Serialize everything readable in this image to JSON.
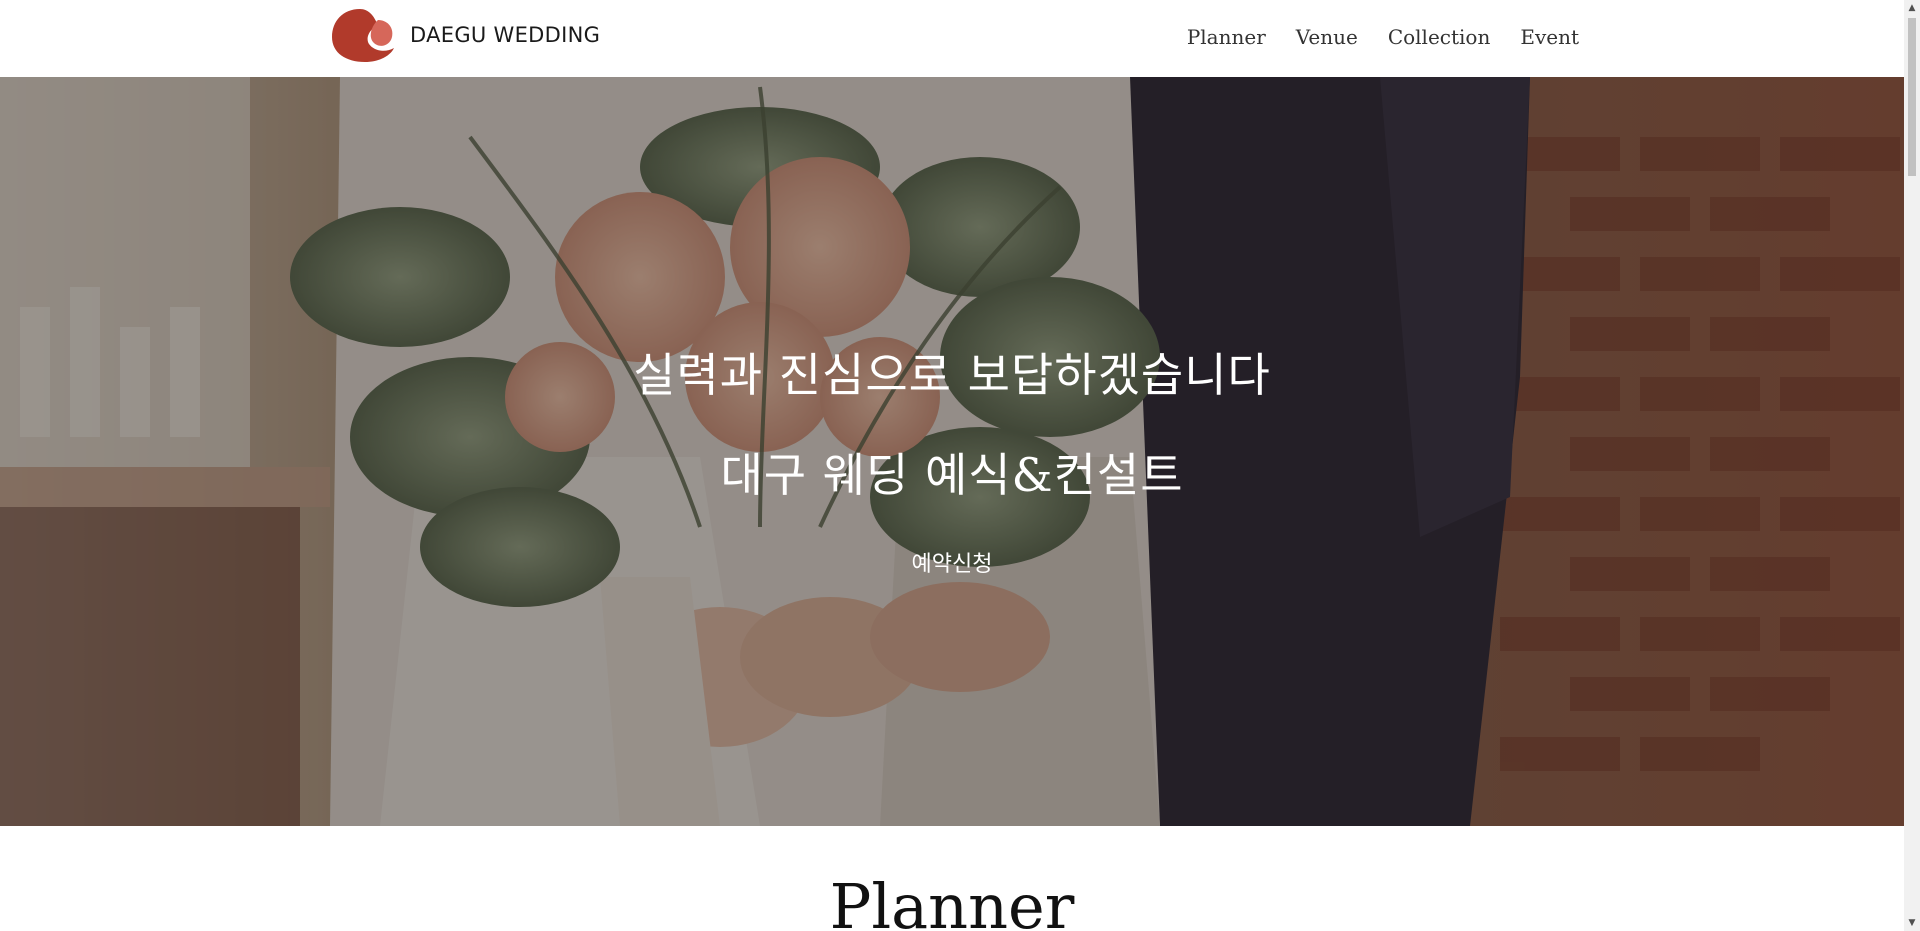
{
  "header": {
    "brand": "DAEGU WEDDING",
    "logo_icon": "red-petal-logo-icon",
    "accent_color": "#b13a2b",
    "nav": [
      {
        "label": "Planner"
      },
      {
        "label": "Venue"
      },
      {
        "label": "Collection"
      },
      {
        "label": "Event"
      }
    ]
  },
  "hero": {
    "line1": "실력과 진심으로 보답하겠습니다",
    "line2": "대구 웨딩 예식&컨설트",
    "cta": "예약신청",
    "background": "wedding-couple-bouquet-photo"
  },
  "section": {
    "title": "Planner"
  }
}
